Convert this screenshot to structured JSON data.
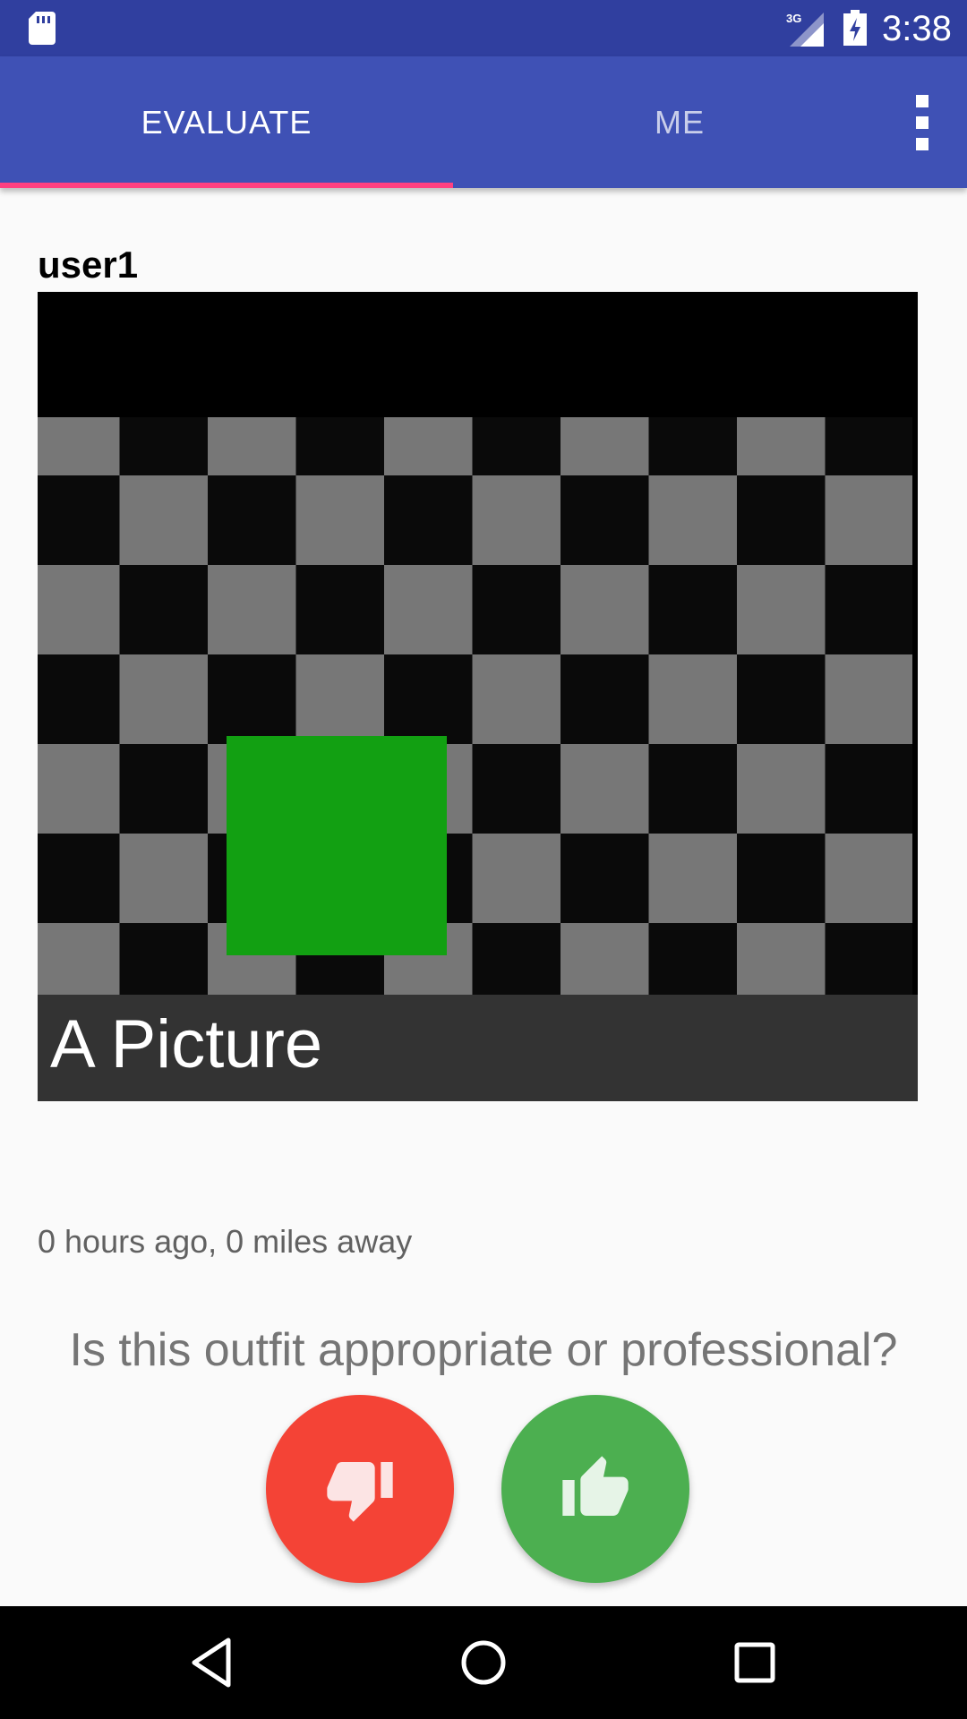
{
  "status_bar": {
    "time": "3:38",
    "network": "3G",
    "icons": [
      "sd-card-icon",
      "signal-icon",
      "battery-charging-icon"
    ]
  },
  "tabs": [
    {
      "label": "EVALUATE",
      "selected": true
    },
    {
      "label": "ME",
      "selected": false
    }
  ],
  "overflow_icon": "more-vert-icon",
  "post": {
    "username": "user1",
    "caption": "A Picture",
    "meta": "0 hours ago, 0 miles away"
  },
  "question": "Is this outfit appropriate or professional?",
  "vote_buttons": {
    "dislike_icon": "thumb-down-icon",
    "like_icon": "thumb-up-icon"
  },
  "nav_bar": {
    "icons": [
      "back-icon",
      "home-icon",
      "recents-icon"
    ]
  },
  "colors": {
    "status_bar": "#303F9F",
    "app_bar": "#3F51B5",
    "tab_indicator": "#FF4081",
    "dislike": "#F44336",
    "like": "#4CAF50",
    "square": "#12A012"
  }
}
